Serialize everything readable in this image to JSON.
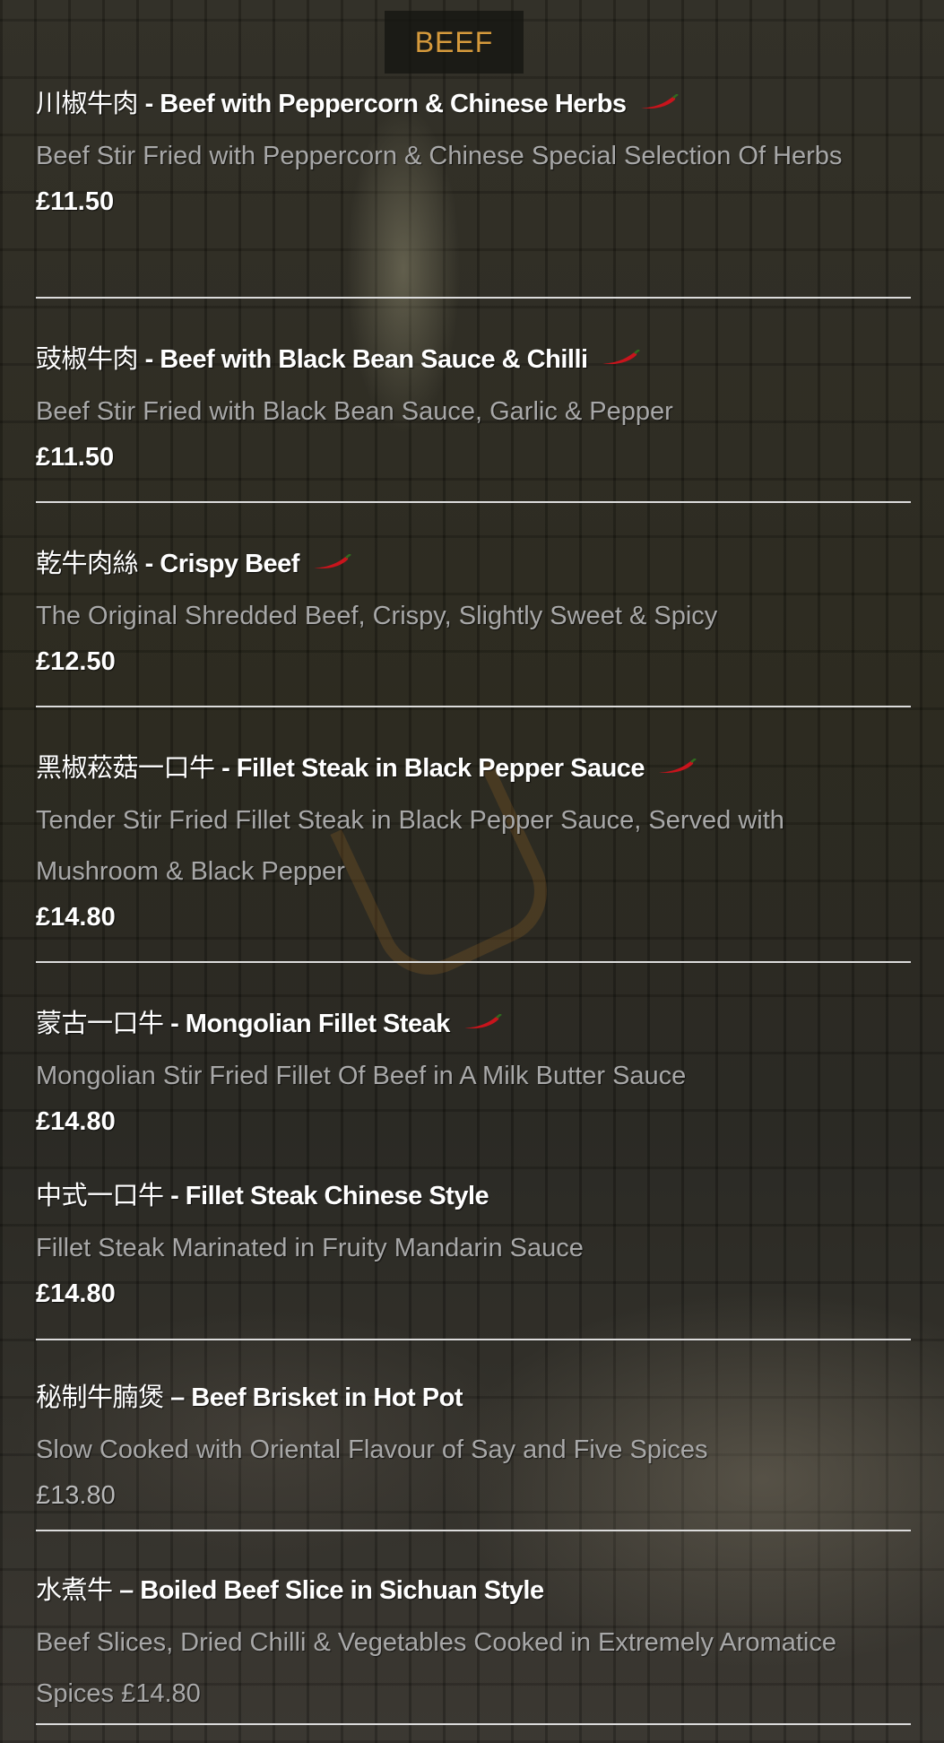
{
  "section": {
    "title": "BEEF"
  },
  "colors": {
    "accent": "#d69a3c",
    "chili": "#c8141c"
  },
  "items": [
    {
      "cn": "川椒牛肉",
      "sep": " - ",
      "en": "Beef with Peppercorn & Chinese Herbs",
      "spicy": true,
      "desc": "Beef Stir Fried with Peppercorn & Chinese Special Selection Of Herbs",
      "price": "£11.50"
    },
    {
      "cn": "豉椒牛肉",
      "sep": " - ",
      "en": "Beef with Black Bean Sauce & Chilli",
      "spicy": true,
      "desc": "Beef Stir Fried with Black Bean Sauce, Garlic & Pepper",
      "price": "£11.50"
    },
    {
      "cn": "乾牛肉絲",
      "sep": " - ",
      "en": "Crispy Beef",
      "spicy": true,
      "desc": "The Original Shredded Beef, Crispy, Slightly Sweet & Spicy",
      "price": "£12.50"
    },
    {
      "cn": "黑椒菘菇一口牛",
      "sep": " - ",
      "en": "Fillet Steak in Black Pepper Sauce",
      "spicy": true,
      "desc": "Tender Stir Fried Fillet Steak in Black Pepper Sauce, Served with Mushroom & Black Pepper",
      "price": "£14.80"
    },
    {
      "cn": "蒙古一口牛",
      "sep": " - ",
      "en": "Mongolian Fillet Steak",
      "spicy": true,
      "desc": "Mongolian Stir Fried Fillet Of Beef in A Milk Butter Sauce",
      "price": "£14.80"
    },
    {
      "cn": "中式一口牛",
      "sep": " - ",
      "en": "Fillet Steak Chinese Style",
      "spicy": false,
      "desc": "Fillet Steak Marinated in Fruity Mandarin Sauce",
      "price": "£14.80"
    },
    {
      "cn": "秘制牛腩煲",
      "sep": " – ",
      "en": "Beef Brisket in Hot Pot",
      "spicy": false,
      "desc": "Slow Cooked with Oriental Flavour of Say and Five Spices",
      "price": "£13.80"
    },
    {
      "cn": "水煮牛",
      "sep": " – ",
      "en": "Boiled Beef Slice in Sichuan Style",
      "spicy": false,
      "desc": "Beef Slices, Dried Chilli & Vegetables Cooked in Extremely Aromatice Spices £14.80",
      "price": ""
    }
  ]
}
